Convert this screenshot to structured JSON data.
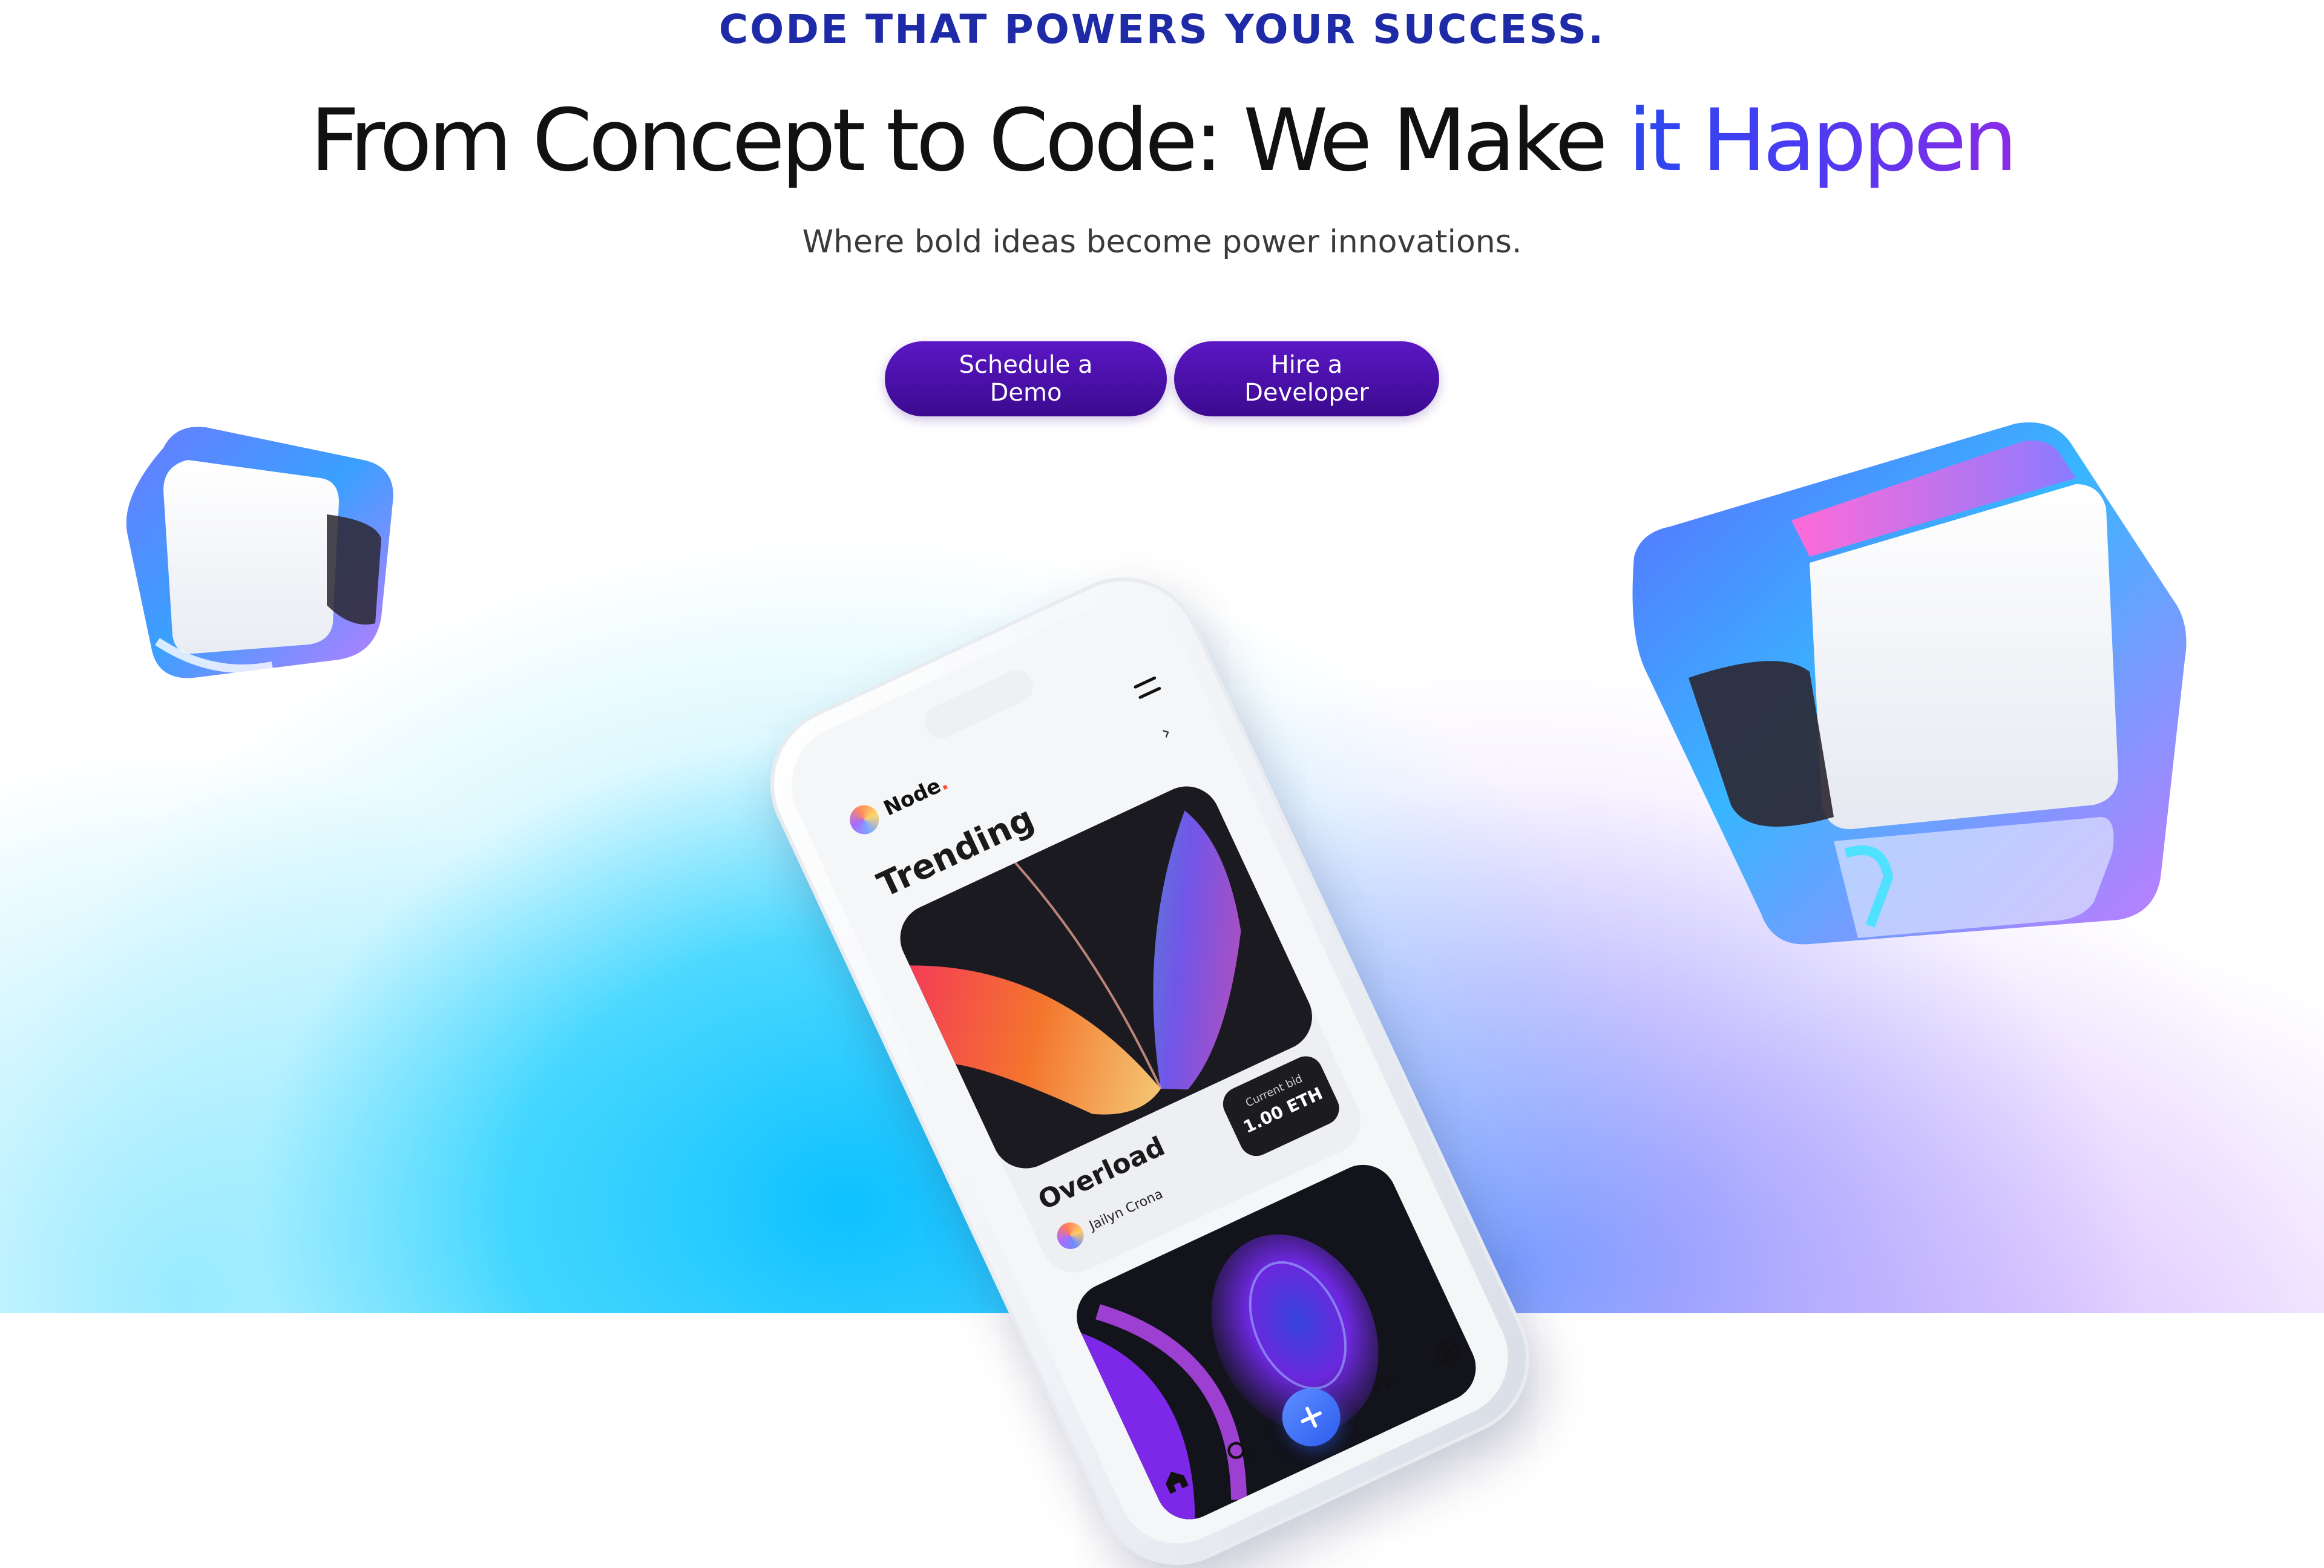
{
  "hero": {
    "eyebrow": "CODE THAT POWERS YOUR SUCCESS.",
    "headline_plain": "From Concept to Code: We Make ",
    "headline_accent": "it Happen",
    "subhead": "Where bold ideas become power innovations."
  },
  "cta": {
    "schedule_demo_label": "Schedule a Demo",
    "hire_developer_label": "Hire a Developer"
  },
  "phone_app": {
    "brand": "Node",
    "brand_dot": ".",
    "section_title": "Trending",
    "see_all": "›",
    "card": {
      "title": "Overload",
      "creator": "Jailyn Crona",
      "bid_label": "Current bid",
      "bid_value": "1.00 ETH"
    },
    "tab_icons": [
      "home-icon",
      "search-icon",
      "plus-icon",
      "activity-icon",
      "profile-icon"
    ]
  },
  "colors": {
    "eyebrow": "#1e2aa6",
    "accent_start": "#2b47f0",
    "accent_end": "#8a2be8",
    "button": "#4a10a8",
    "backdrop_cyan": "#00c3ff",
    "backdrop_violet": "#8a8cff"
  }
}
